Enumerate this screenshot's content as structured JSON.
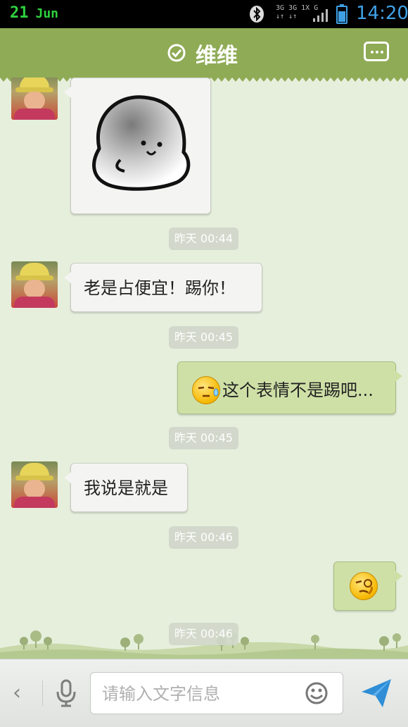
{
  "status_bar": {
    "day": "21",
    "month": "Jun",
    "network_line1": "3G 3G 1X  G",
    "network_line2": "↓↑ ↓↑",
    "time": "14:20"
  },
  "header": {
    "title": "维维",
    "icons": {
      "verified": "check-circle-icon",
      "more": "more-options-icon"
    }
  },
  "colors": {
    "header": "#8fab56",
    "background": "#e6efdc",
    "incoming_bubble": "#f4f4f2",
    "outgoing_bubble": "#cfe0a7",
    "time_accent": "#3fa0e6"
  },
  "messages": {
    "m1": {
      "direction": "incoming",
      "type": "sticker",
      "sticker": "blob-ghost-sticker"
    },
    "t1": "昨天 00:44",
    "m2": {
      "direction": "incoming",
      "text": "老是占便宜！踢你！"
    },
    "t2": "昨天 00:45",
    "m3": {
      "direction": "outgoing",
      "emoji": "sweat-face-emoji",
      "text": "这个表情不是踢吧..."
    },
    "t3": "昨天 00:45",
    "m4": {
      "direction": "incoming",
      "text": "我说是就是"
    },
    "t4": "昨天 00:46",
    "m5": {
      "direction": "outgoing",
      "emoji": "thinking-face-emoji"
    },
    "t5": "昨天 00:46"
  },
  "input_bar": {
    "placeholder": "请输入文字信息",
    "icons": {
      "back": "chevron-left-icon",
      "voice": "microphone-icon",
      "emoji": "smiley-icon",
      "send": "send-icon"
    }
  }
}
